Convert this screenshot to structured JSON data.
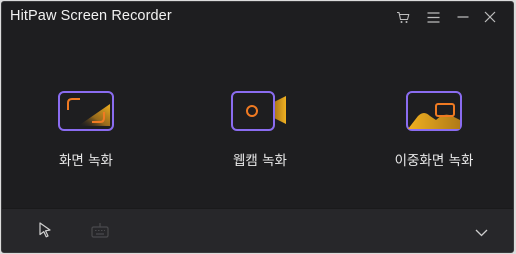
{
  "window": {
    "title": "HitPaw Screen Recorder"
  },
  "titlebar": {
    "icons": [
      "cart-icon",
      "menu-icon",
      "minimize-icon",
      "close-icon"
    ]
  },
  "modes": [
    {
      "label": "화면 녹화",
      "icon": "screen-record-icon"
    },
    {
      "label": "웹캠 녹화",
      "icon": "webcam-record-icon"
    },
    {
      "label": "이중화면 녹화",
      "icon": "picture-in-picture-icon"
    }
  ],
  "bottombar": {
    "icons": [
      "cursor-icon",
      "keyboard-icon",
      "chevron-down-icon"
    ]
  },
  "colors": {
    "accent_purple": "#8a6cf0",
    "accent_orange": "#f07a22",
    "accent_yellow": "#f0b020",
    "background": "#1e1e20",
    "bottombar": "#27272a"
  }
}
